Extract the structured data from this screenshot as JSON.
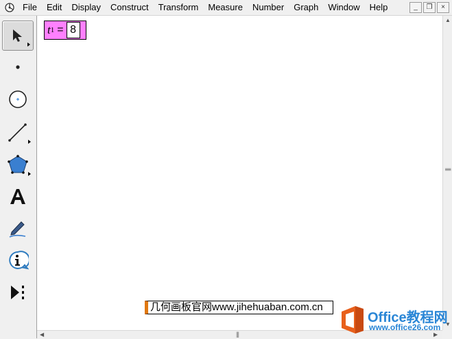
{
  "menu": {
    "items": [
      "File",
      "Edit",
      "Display",
      "Construct",
      "Transform",
      "Measure",
      "Number",
      "Graph",
      "Window",
      "Help"
    ]
  },
  "window_buttons": {
    "minimize": "_",
    "restore": "❐",
    "close": "×"
  },
  "tools": [
    {
      "name": "arrow-tool",
      "icon": "arrow-icon",
      "selected": true
    },
    {
      "name": "point-tool",
      "icon": "point-icon"
    },
    {
      "name": "compass-tool",
      "icon": "circle-icon"
    },
    {
      "name": "straightedge-tool",
      "icon": "line-icon"
    },
    {
      "name": "polygon-tool",
      "icon": "polygon-icon"
    },
    {
      "name": "text-tool",
      "icon": "text-a-icon"
    },
    {
      "name": "marker-tool",
      "icon": "marker-pen-icon"
    },
    {
      "name": "information-tool",
      "icon": "info-icon"
    },
    {
      "name": "custom-tool",
      "icon": "custom-tools-icon"
    }
  ],
  "parameter": {
    "variable": "t",
    "subscript": "1",
    "equals": "=",
    "value": "8"
  },
  "watermark": {
    "caption": "几何画板官网www.jihehuaban.com.cn",
    "brand_name": "Office教程网",
    "brand_url": "www.office26.com"
  },
  "colors": {
    "parameter_bg": "#ff80ff",
    "brand_blue": "#2a86d6",
    "brand_orange": "#e8601c"
  }
}
